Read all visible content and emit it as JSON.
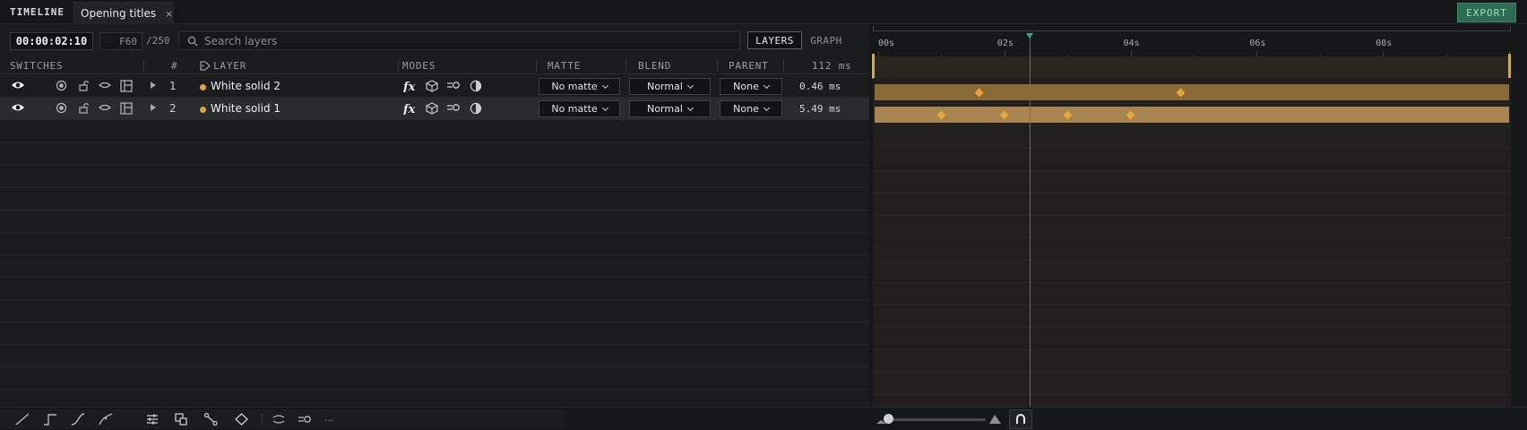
{
  "app": {
    "title": "TIMELINE",
    "tab_name": "Opening titles",
    "tab_close": "×",
    "export_label": "EXPORT"
  },
  "toolbar": {
    "timecode": "00:00:02:10",
    "frame": "F60",
    "total_frames": "/250",
    "search_placeholder": "Search layers",
    "view_layers": "LAYERS",
    "view_graph": "GRAPH"
  },
  "columns": {
    "switches": "SWITCHES",
    "index": "#",
    "layer": "LAYER",
    "modes": "MODES",
    "matte": "MATTE",
    "blend": "BLEND",
    "parent": "PARENT",
    "total_ms": "112 ms"
  },
  "layers": [
    {
      "index": "1",
      "name": "White solid 2",
      "matte": "No matte",
      "blend": "Normal",
      "parent": "None",
      "ms": "0.46 ms",
      "keyframes": [
        1.6,
        4.8
      ],
      "selected": false
    },
    {
      "index": "2",
      "name": "White solid 1",
      "matte": "No matte",
      "blend": "Normal",
      "parent": "None",
      "ms": "5.49 ms",
      "keyframes": [
        1.0,
        2.0,
        3.0,
        4.0
      ],
      "selected": true
    }
  ],
  "ruler": {
    "labels": [
      "00s",
      "02s",
      "04s",
      "06s",
      "08s"
    ],
    "seconds": [
      0,
      2,
      4,
      6,
      8
    ],
    "max_seconds": 10,
    "playhead_seconds": 2.4
  },
  "colors": {
    "accent_green": "#2e6b52",
    "layer_bar": "#e0a538",
    "work_area_line": "#5fc3a8",
    "playhead": "#2f8a6e"
  },
  "bottom": {
    "more": "..."
  }
}
